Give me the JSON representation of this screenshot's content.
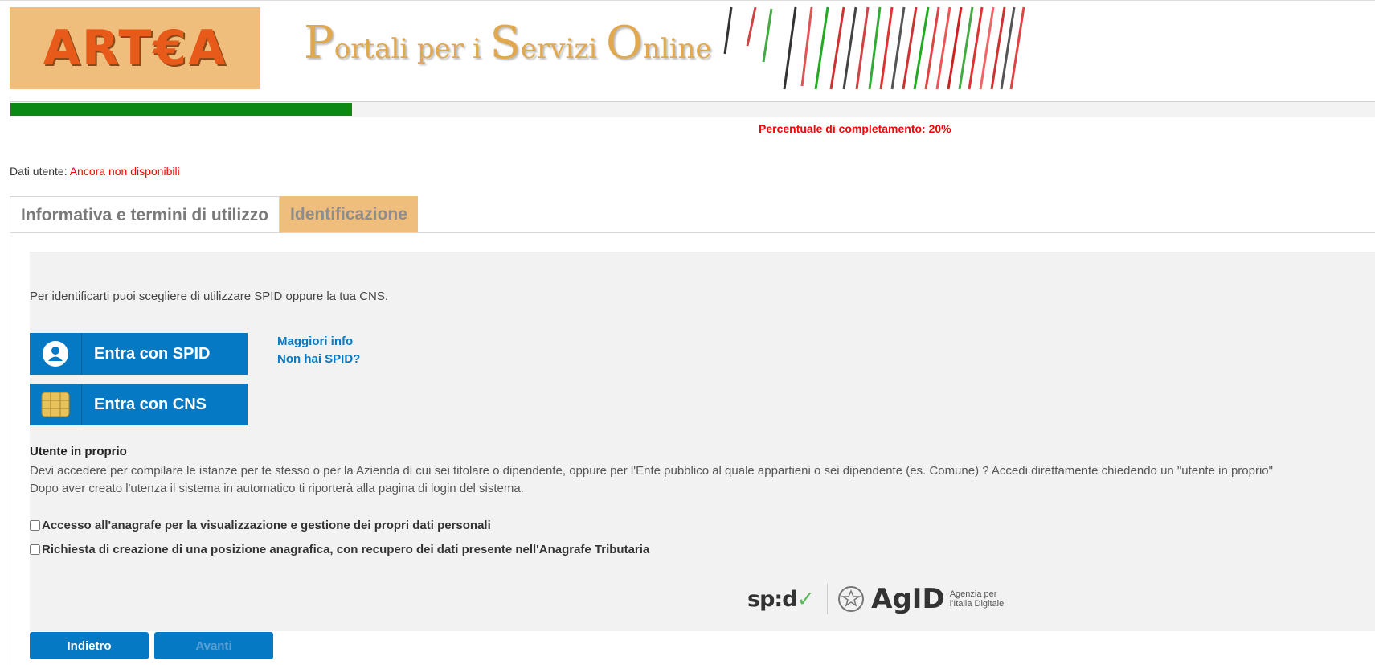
{
  "header": {
    "logo_text": "ART€A",
    "portal_title_parts": [
      "P",
      "ortali per i ",
      "S",
      "ervizi ",
      "O",
      "nline"
    ]
  },
  "progress": {
    "value": 0.25,
    "label": "Percentuale di completamento: 20%"
  },
  "user": {
    "label": "Dati utente: ",
    "value": "Ancora non disponibili"
  },
  "tabs": [
    {
      "label": "Informativa e termini di utilizzo",
      "active": false
    },
    {
      "label": "Identificazione",
      "active": true
    }
  ],
  "identification": {
    "intro": "Per identificarti puoi scegliere di utilizzare SPID oppure la tua CNS.",
    "spid_button": "Entra con SPID",
    "cns_button": "Entra con CNS",
    "links": [
      "Maggiori info",
      "Non hai SPID?"
    ],
    "owner_title": "Utente in proprio",
    "owner_text_1": "Devi accedere per compilare le istanze per te stesso o per la Azienda di cui sei titolare o dipendente, oppure per l'Ente pubblico al quale appartieni o sei dipendente (es. Comune) ? Accedi direttamente chiedendo un \"utente in proprio\"",
    "owner_text_2": "Dopo aver creato l'utenza il sistema in automatico ti riporterà alla pagina di login del sistema.",
    "checkboxes": [
      {
        "label": "Accesso all'anagrafe per la visualizzazione e gestione dei propri dati personali",
        "checked": false
      },
      {
        "label": "Richiesta di creazione di una posizione anagrafica, con recupero dei dati presente nell'Anagrafe Tributaria",
        "checked": false
      }
    ],
    "spid_logo": "sp:d",
    "agid_logo": "AgID",
    "agid_sub_1": "Agenzia per",
    "agid_sub_2": "l'Italia Digitale"
  },
  "footer": {
    "back_label": "Indietro",
    "next_label": "Avanti"
  },
  "colors": {
    "accent": "#0679c5",
    "progress": "#0a8a15",
    "tab_active": "#f0be7c",
    "alert": "#ff0000"
  }
}
